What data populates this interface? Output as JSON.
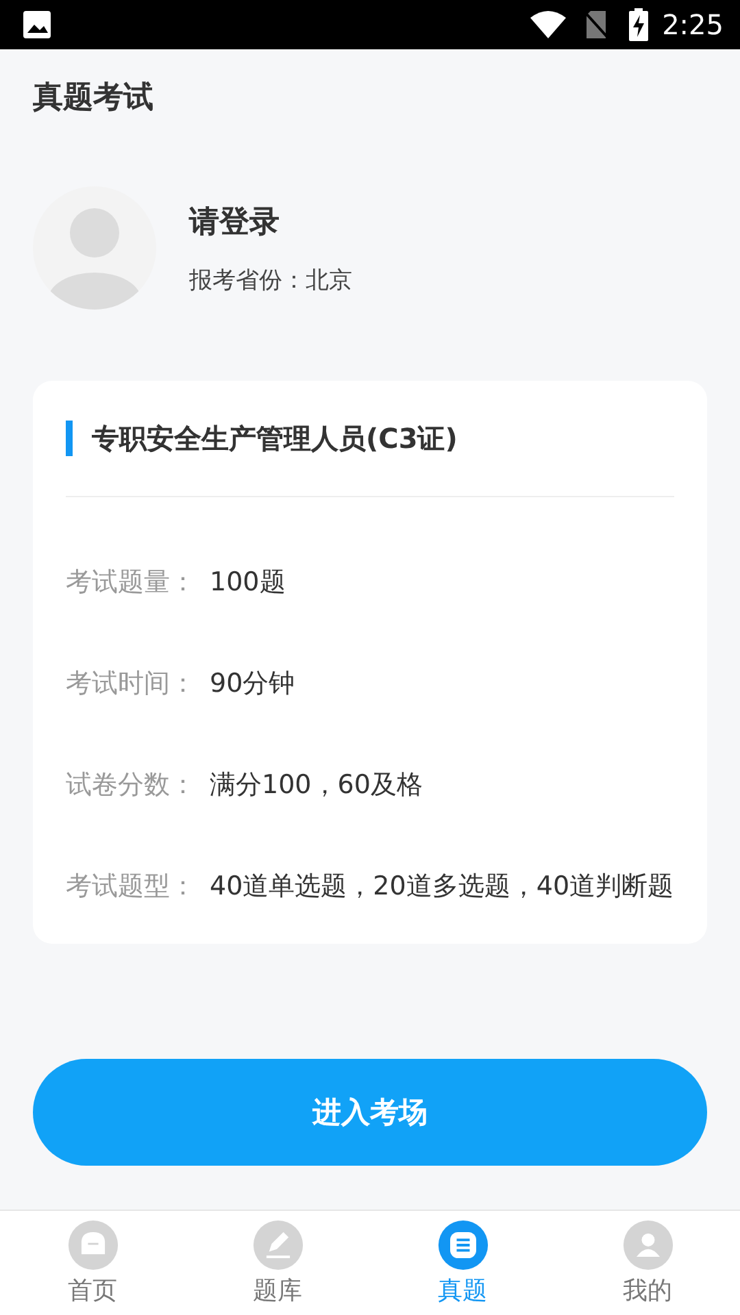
{
  "status_bar": {
    "time": "2:25"
  },
  "header": {
    "title": "真题考试"
  },
  "profile": {
    "name": "请登录",
    "province_label": "报考省份：",
    "province": "北京"
  },
  "exam_card": {
    "title": "专职安全生产管理人员(C3证)",
    "rows": [
      {
        "label": "考试题量：",
        "value": "100题"
      },
      {
        "label": "考试时间：",
        "value": "90分钟"
      },
      {
        "label": "试卷分数：",
        "value": "满分100，60及格"
      },
      {
        "label": "考试题型：",
        "value": "40道单选题，20道多选题，40道判断题"
      }
    ]
  },
  "enter_button": {
    "label": "进入考场"
  },
  "tabs": [
    {
      "label": "首页",
      "selected": false
    },
    {
      "label": "题库",
      "selected": false
    },
    {
      "label": "真题",
      "selected": true
    },
    {
      "label": "我的",
      "selected": false
    }
  ]
}
